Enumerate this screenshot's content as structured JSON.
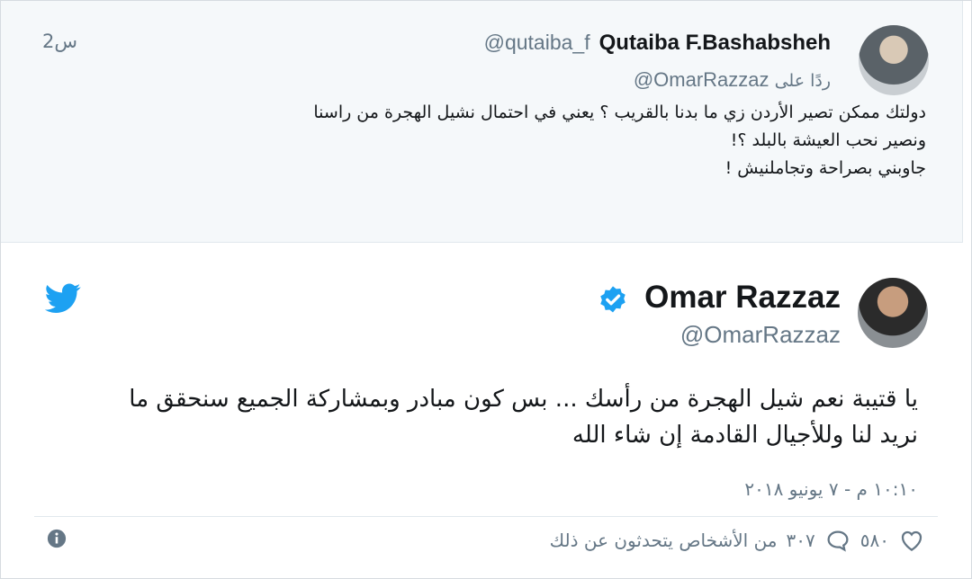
{
  "reply_tweet": {
    "name": "Qutaiba F.Bashabsheh",
    "handle": "@qutaiba_f",
    "time": "2س",
    "replying_to_label": "ردًا على",
    "replying_to_handle": "@OmarRazzaz",
    "lines": [
      "دولتك ممكن تصير الأردن زي ما بدنا بالقريب ؟ يعني في احتمال نشيل الهجرة من راسنا",
      "ونصير نحب العيشة بالبلد ؟!",
      "جاوبني بصراحة وتجاملنيش !"
    ]
  },
  "main_tweet": {
    "name": "Omar Razzaz",
    "handle": "@OmarRazzaz",
    "verified": true,
    "lines": [
      "يا قتيبة  نعم شيل الهجرة من رأسك ... بس كون مبادر  وبمشاركة الجميع سنحقق ما",
      "نريد لنا وللأجيال القادمة إن شاء الله"
    ],
    "timestamp": "١٠:١٠ م - ٧ يونيو ٢٠١٨",
    "likes": "٥٨٠",
    "replies": "٣٠٧",
    "replies_label": "من الأشخاص يتحدثون عن ذلك"
  },
  "colors": {
    "accent": "#1da1f2",
    "reply_background": "#f5f8fa",
    "muted_text": "#657786",
    "divider": "#e1e8ed"
  },
  "icons": {
    "brand": "twitter-bird-icon",
    "verified": "verified-badge-icon",
    "like": "heart-icon",
    "reply": "comment-bubble-icon",
    "info": "info-icon"
  }
}
